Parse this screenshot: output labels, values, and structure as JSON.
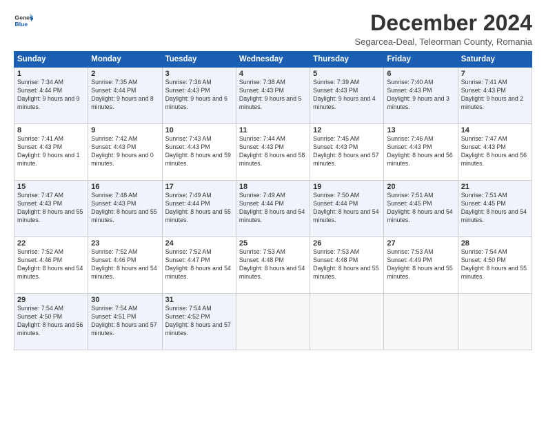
{
  "header": {
    "logo_line1": "General",
    "logo_line2": "Blue",
    "month_title": "December 2024",
    "subtitle": "Segarcea-Deal, Teleorman County, Romania"
  },
  "days_of_week": [
    "Sunday",
    "Monday",
    "Tuesday",
    "Wednesday",
    "Thursday",
    "Friday",
    "Saturday"
  ],
  "weeks": [
    [
      {
        "day": "1",
        "text": "Sunrise: 7:34 AM\nSunset: 4:44 PM\nDaylight: 9 hours and 9 minutes."
      },
      {
        "day": "2",
        "text": "Sunrise: 7:35 AM\nSunset: 4:44 PM\nDaylight: 9 hours and 8 minutes."
      },
      {
        "day": "3",
        "text": "Sunrise: 7:36 AM\nSunset: 4:43 PM\nDaylight: 9 hours and 6 minutes."
      },
      {
        "day": "4",
        "text": "Sunrise: 7:38 AM\nSunset: 4:43 PM\nDaylight: 9 hours and 5 minutes."
      },
      {
        "day": "5",
        "text": "Sunrise: 7:39 AM\nSunset: 4:43 PM\nDaylight: 9 hours and 4 minutes."
      },
      {
        "day": "6",
        "text": "Sunrise: 7:40 AM\nSunset: 4:43 PM\nDaylight: 9 hours and 3 minutes."
      },
      {
        "day": "7",
        "text": "Sunrise: 7:41 AM\nSunset: 4:43 PM\nDaylight: 9 hours and 2 minutes."
      }
    ],
    [
      {
        "day": "8",
        "text": "Sunrise: 7:41 AM\nSunset: 4:43 PM\nDaylight: 9 hours and 1 minute."
      },
      {
        "day": "9",
        "text": "Sunrise: 7:42 AM\nSunset: 4:43 PM\nDaylight: 9 hours and 0 minutes."
      },
      {
        "day": "10",
        "text": "Sunrise: 7:43 AM\nSunset: 4:43 PM\nDaylight: 8 hours and 59 minutes."
      },
      {
        "day": "11",
        "text": "Sunrise: 7:44 AM\nSunset: 4:43 PM\nDaylight: 8 hours and 58 minutes."
      },
      {
        "day": "12",
        "text": "Sunrise: 7:45 AM\nSunset: 4:43 PM\nDaylight: 8 hours and 57 minutes."
      },
      {
        "day": "13",
        "text": "Sunrise: 7:46 AM\nSunset: 4:43 PM\nDaylight: 8 hours and 56 minutes."
      },
      {
        "day": "14",
        "text": "Sunrise: 7:47 AM\nSunset: 4:43 PM\nDaylight: 8 hours and 56 minutes."
      }
    ],
    [
      {
        "day": "15",
        "text": "Sunrise: 7:47 AM\nSunset: 4:43 PM\nDaylight: 8 hours and 55 minutes."
      },
      {
        "day": "16",
        "text": "Sunrise: 7:48 AM\nSunset: 4:43 PM\nDaylight: 8 hours and 55 minutes."
      },
      {
        "day": "17",
        "text": "Sunrise: 7:49 AM\nSunset: 4:44 PM\nDaylight: 8 hours and 55 minutes."
      },
      {
        "day": "18",
        "text": "Sunrise: 7:49 AM\nSunset: 4:44 PM\nDaylight: 8 hours and 54 minutes."
      },
      {
        "day": "19",
        "text": "Sunrise: 7:50 AM\nSunset: 4:44 PM\nDaylight: 8 hours and 54 minutes."
      },
      {
        "day": "20",
        "text": "Sunrise: 7:51 AM\nSunset: 4:45 PM\nDaylight: 8 hours and 54 minutes."
      },
      {
        "day": "21",
        "text": "Sunrise: 7:51 AM\nSunset: 4:45 PM\nDaylight: 8 hours and 54 minutes."
      }
    ],
    [
      {
        "day": "22",
        "text": "Sunrise: 7:52 AM\nSunset: 4:46 PM\nDaylight: 8 hours and 54 minutes."
      },
      {
        "day": "23",
        "text": "Sunrise: 7:52 AM\nSunset: 4:46 PM\nDaylight: 8 hours and 54 minutes."
      },
      {
        "day": "24",
        "text": "Sunrise: 7:52 AM\nSunset: 4:47 PM\nDaylight: 8 hours and 54 minutes."
      },
      {
        "day": "25",
        "text": "Sunrise: 7:53 AM\nSunset: 4:48 PM\nDaylight: 8 hours and 54 minutes."
      },
      {
        "day": "26",
        "text": "Sunrise: 7:53 AM\nSunset: 4:48 PM\nDaylight: 8 hours and 55 minutes."
      },
      {
        "day": "27",
        "text": "Sunrise: 7:53 AM\nSunset: 4:49 PM\nDaylight: 8 hours and 55 minutes."
      },
      {
        "day": "28",
        "text": "Sunrise: 7:54 AM\nSunset: 4:50 PM\nDaylight: 8 hours and 55 minutes."
      }
    ],
    [
      {
        "day": "29",
        "text": "Sunrise: 7:54 AM\nSunset: 4:50 PM\nDaylight: 8 hours and 56 minutes."
      },
      {
        "day": "30",
        "text": "Sunrise: 7:54 AM\nSunset: 4:51 PM\nDaylight: 8 hours and 57 minutes."
      },
      {
        "day": "31",
        "text": "Sunrise: 7:54 AM\nSunset: 4:52 PM\nDaylight: 8 hours and 57 minutes."
      },
      {
        "day": "",
        "text": ""
      },
      {
        "day": "",
        "text": ""
      },
      {
        "day": "",
        "text": ""
      },
      {
        "day": "",
        "text": ""
      }
    ]
  ]
}
